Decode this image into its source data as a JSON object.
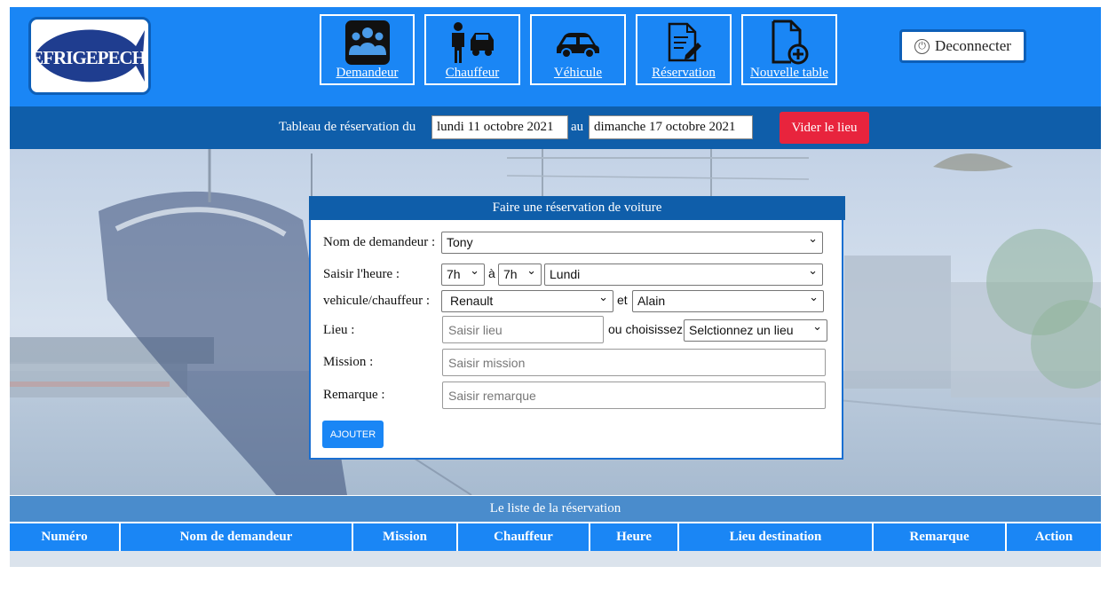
{
  "header": {
    "logo_text": "REFRIGEPECHE",
    "nav": [
      {
        "label": "Demandeur",
        "icon": "people-group-icon"
      },
      {
        "label": "Chauffeur",
        "icon": "driver-car-icon"
      },
      {
        "label": "Véhicule",
        "icon": "car-icon"
      },
      {
        "label": "Réservation",
        "icon": "document-edit-icon"
      },
      {
        "label": "Nouvelle table",
        "icon": "file-plus-icon"
      }
    ],
    "logout_label": "Deconnecter",
    "logout_icon": "power-icon"
  },
  "datebar": {
    "prefix": "Tableau de réservation du",
    "start_date": "lundi 11 octobre 2021",
    "middle": "au",
    "end_date": "dimanche 17 octobre 2021",
    "clear_button": "Vider le lieu"
  },
  "form": {
    "title": "Faire une réservation de voiture",
    "demandeur_label": "Nom de demandeur :",
    "demandeur_value": "Tony",
    "heure_label": "Saisir l'heure :",
    "heure_from": "7h",
    "heure_sep": "à",
    "heure_to": "7h",
    "jour_value": "Lundi",
    "vehicule_label": "vehicule/chauffeur :",
    "vehicule_value": "Renault",
    "et_label": "et",
    "chauffeur_value": "Alain",
    "lieu_label": "Lieu :",
    "lieu_placeholder": "Saisir lieu",
    "ou_label": "ou choisissez",
    "lieu_select": "Selctionnez un lieu",
    "mission_label": "Mission :",
    "mission_placeholder": "Saisir mission",
    "remarque_label": "Remarque :",
    "remarque_placeholder": "Saisir remarque",
    "submit_label": "AJOUTER"
  },
  "list": {
    "title": "Le liste de la réservation",
    "columns": [
      "Numéro",
      "Nom de demandeur",
      "Mission",
      "Chauffeur",
      "Heure",
      "Lieu destination",
      "Remarque",
      "Action"
    ]
  },
  "colors": {
    "primary": "#1a86f5",
    "dark": "#0f5eaa",
    "danger": "#e8243d"
  }
}
